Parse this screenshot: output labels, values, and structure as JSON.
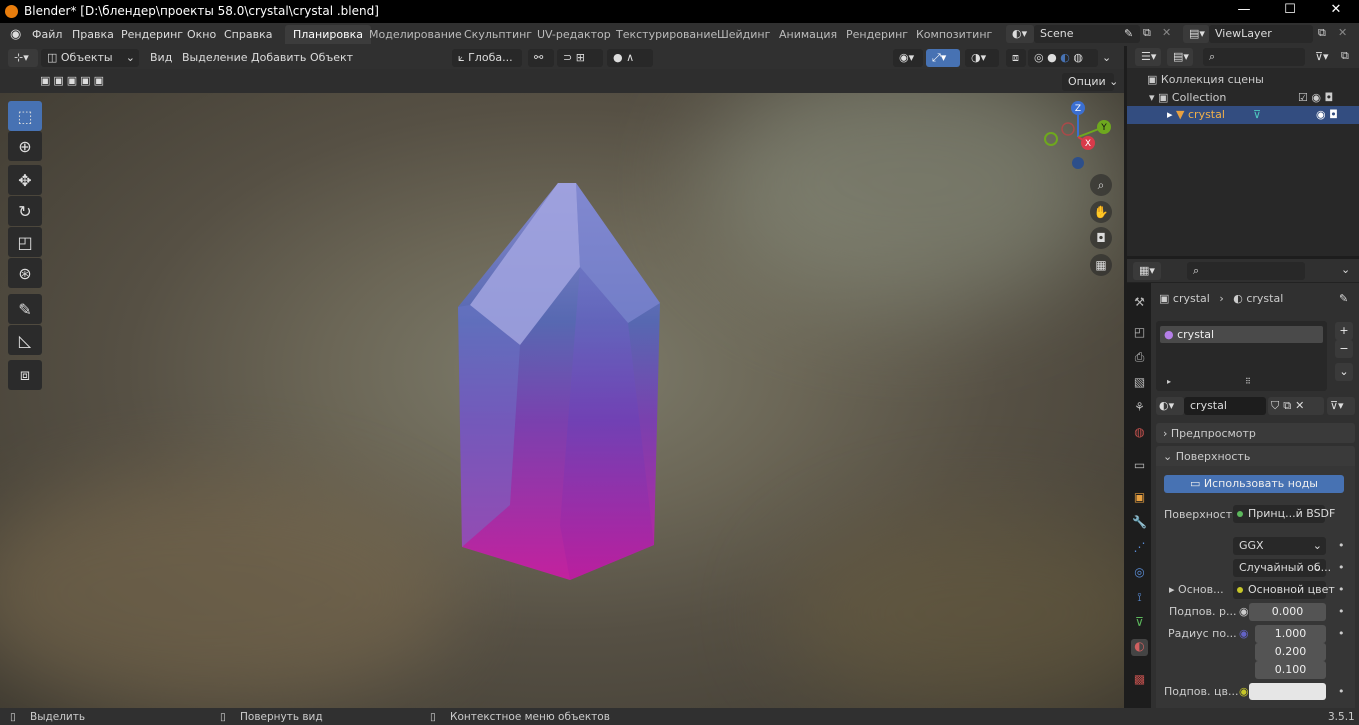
{
  "window": {
    "title": "Blender* [D:\\блендер\\проекты 58.0\\crystal\\crystal .blend]",
    "min": "—",
    "max": "☐",
    "close": "✕"
  },
  "menu": [
    "Файл",
    "Правка",
    "Рендеринг",
    "Окно",
    "Справка"
  ],
  "workspaces": [
    "Планировка",
    "Моделирование",
    "Скульптинг",
    "UV-редактор",
    "Текстурирование",
    "Шейдинг",
    "Анимация",
    "Рендеринг",
    "Композитинг"
  ],
  "scene": {
    "name": "Scene",
    "viewlayer": "ViewLayer"
  },
  "viewport_header": {
    "mode": "Объекты",
    "view": "Вид",
    "select": "Выделение",
    "add": "Добавить",
    "object": "Объект",
    "orientation": "Глоба...",
    "options": "Опции"
  },
  "gizmo": {
    "z": "Z",
    "y": "Y",
    "x": "X"
  },
  "outliner": {
    "scene_collection": "Коллекция сцены",
    "collection": "Collection",
    "object": "crystal"
  },
  "properties": {
    "breadcrumb_obj": "crystal",
    "breadcrumb_mat": "crystal",
    "slot": "crystal",
    "material_name": "crystal",
    "preview": "Предпросмотр",
    "surface_panel": "Поверхность",
    "use_nodes": "Использовать ноды",
    "surface_label": "Поверхность",
    "surface_value": "Принц...й BSDF",
    "distribution": "GGX",
    "subsurface_method": "Случайный об...",
    "base_label": "Основ...",
    "base_value": "Основной цвет",
    "subsurface_label": "Подпов. р...",
    "subsurface_value": "0.000",
    "radius_label": "Радиус по...",
    "radius_values": [
      "1.000",
      "0.200",
      "0.100"
    ],
    "subsurface_color_label": "Подпов. цв..."
  },
  "status": {
    "select": "Выделить",
    "rotate": "Повернуть вид",
    "context": "Контекстное меню объектов",
    "version": "3.5.1"
  },
  "colors": {
    "accent": "#4772b3",
    "crystal_top": "#8a8fd8",
    "crystal_bottom": "#cc1ca5"
  }
}
